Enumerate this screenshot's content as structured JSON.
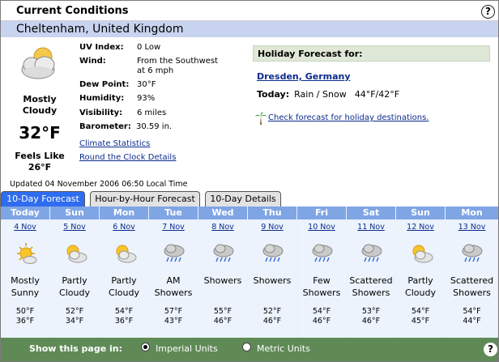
{
  "header": {
    "title": "Current Conditions",
    "help": "?"
  },
  "location": "Cheltenham, United Kingdom",
  "current": {
    "icon": "mostly-cloudy-icon",
    "condition_line1": "Mostly",
    "condition_line2": "Cloudy",
    "temp": "32°F",
    "feels_like_label": "Feels Like",
    "feels_like": "26°F"
  },
  "details": [
    {
      "label": "UV Index:",
      "value": "0 Low"
    },
    {
      "label": "Wind:",
      "value": "From the Southwest",
      "value2": "at 6 mph"
    },
    {
      "label": "Dew Point:",
      "value": "30°F"
    },
    {
      "label": "Humidity:",
      "value": "93%"
    },
    {
      "label": "Visibility:",
      "value": "6 miles"
    },
    {
      "label": "Barometer:",
      "value": "30.59 in."
    }
  ],
  "links": {
    "climate": "Climate Statistics",
    "round_clock": "Round the Clock Details"
  },
  "holiday": {
    "title": "Holiday Forecast for:",
    "city": "Dresden, Germany",
    "today_label": "Today:",
    "today_cond": "Rain / Snow",
    "today_temps": "44°F/42°F",
    "check_link": "Check forecast for holiday destinations."
  },
  "updated": "Updated 04 November 2006 06:50 Local Time",
  "tabs": [
    {
      "label": "10-Day Forecast",
      "active": true
    },
    {
      "label": "Hour-by-Hour Forecast",
      "active": false
    },
    {
      "label": "10-Day Details",
      "active": false
    }
  ],
  "forecast": [
    {
      "day": "Today",
      "date": "4 Nov",
      "icon": "partly-sunny-icon",
      "cond1": "Mostly",
      "cond2": "Sunny",
      "hi": "50°F",
      "lo": "36°F"
    },
    {
      "day": "Sun",
      "date": "5 Nov",
      "icon": "partly-cloudy-icon",
      "cond1": "Partly",
      "cond2": "Cloudy",
      "hi": "52°F",
      "lo": "34°F"
    },
    {
      "day": "Mon",
      "date": "6 Nov",
      "icon": "partly-cloudy-icon",
      "cond1": "Partly",
      "cond2": "Cloudy",
      "hi": "54°F",
      "lo": "36°F"
    },
    {
      "day": "Tue",
      "date": "7 Nov",
      "icon": "showers-icon",
      "cond1": "AM",
      "cond2": "Showers",
      "hi": "57°F",
      "lo": "43°F"
    },
    {
      "day": "Wed",
      "date": "8 Nov",
      "icon": "showers-icon",
      "cond1": "Showers",
      "cond2": "",
      "hi": "55°F",
      "lo": "46°F"
    },
    {
      "day": "Thu",
      "date": "9 Nov",
      "icon": "showers-icon",
      "cond1": "Showers",
      "cond2": "",
      "hi": "52°F",
      "lo": "46°F"
    },
    {
      "day": "Fri",
      "date": "10 Nov",
      "icon": "showers-icon",
      "cond1": "Few",
      "cond2": "Showers",
      "hi": "54°F",
      "lo": "46°F"
    },
    {
      "day": "Sat",
      "date": "11 Nov",
      "icon": "showers-icon",
      "cond1": "Scattered",
      "cond2": "Showers",
      "hi": "53°F",
      "lo": "46°F"
    },
    {
      "day": "Sun",
      "date": "12 Nov",
      "icon": "partly-cloudy-icon",
      "cond1": "Partly",
      "cond2": "Cloudy",
      "hi": "54°F",
      "lo": "45°F"
    },
    {
      "day": "Mon",
      "date": "13 Nov",
      "icon": "showers-icon",
      "cond1": "Scattered",
      "cond2": "Showers",
      "hi": "54°F",
      "lo": "44°F"
    }
  ],
  "footer": {
    "show_label": "Show this page in:",
    "imperial": "Imperial Units",
    "metric": "Metric Units",
    "selected": "imperial",
    "help": "?"
  },
  "colors": {
    "location_bar": "#c8d3ef",
    "day_header": "#7fa5e4",
    "active_tab": "#2f6df0",
    "footer": "#5f8a56",
    "holiday_bar": "#dfe8d6",
    "link": "#0b2b8f"
  }
}
